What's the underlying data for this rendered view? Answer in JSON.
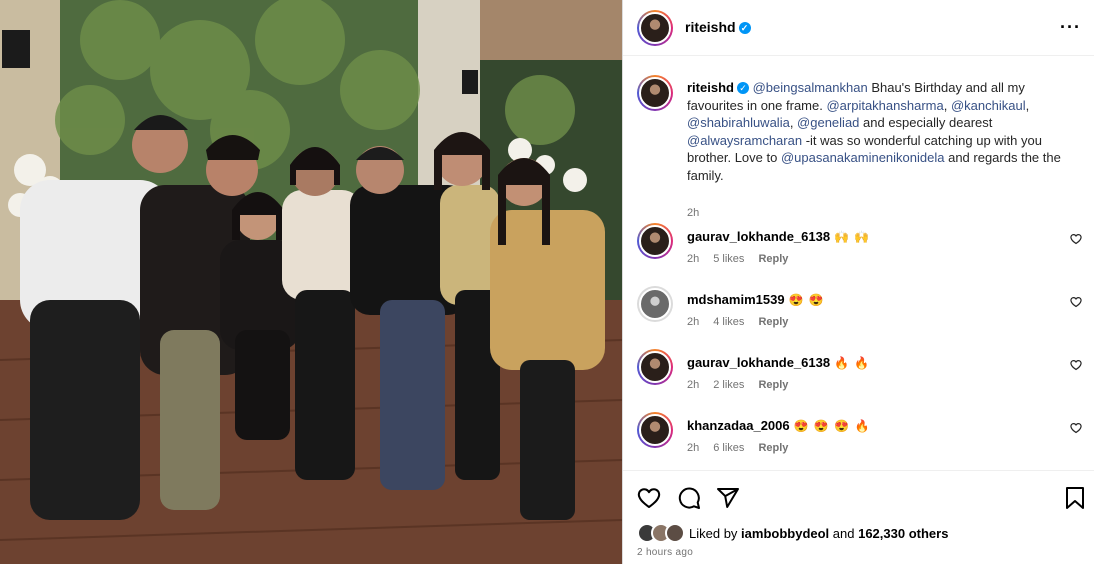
{
  "post": {
    "author": "riteishd",
    "more_icon": "more-horizontal-icon",
    "photo_alt": "Group photo of eight friends posing together indoors"
  },
  "caption": {
    "author": "riteishd",
    "segments": [
      {
        "type": "mention",
        "text": "@beingsalmankhan"
      },
      {
        "type": "text",
        "text": " Bhau's Birthday and all my favourites in one frame. "
      },
      {
        "type": "mention",
        "text": "@arpitakhansharma"
      },
      {
        "type": "text",
        "text": ", "
      },
      {
        "type": "mention",
        "text": "@kanchikaul"
      },
      {
        "type": "text",
        "text": ", "
      },
      {
        "type": "mention",
        "text": "@shabirahluwalia"
      },
      {
        "type": "text",
        "text": ", "
      },
      {
        "type": "mention",
        "text": "@geneliad"
      },
      {
        "type": "text",
        "text": " and especially dearest "
      },
      {
        "type": "mention",
        "text": "@alwaysramcharan"
      },
      {
        "type": "text",
        "text": " -it was so wonderful catching up with you brother. Love to "
      },
      {
        "type": "mention",
        "text": "@upasanakaminenikonidela"
      },
      {
        "type": "text",
        "text": " and regards the the family."
      }
    ],
    "time": "2h"
  },
  "comments": [
    {
      "user": "gaurav_lokhande_6138",
      "text": "🙌 🙌",
      "time": "2h",
      "likes": "5 likes",
      "reply": "Reply",
      "avatar": "dark"
    },
    {
      "user": "mdshamim1539",
      "text": "😍 😍",
      "time": "2h",
      "likes": "4 likes",
      "reply": "Reply",
      "avatar": "light"
    },
    {
      "user": "gaurav_lokhande_6138",
      "text": "🔥 🔥",
      "time": "2h",
      "likes": "2 likes",
      "reply": "Reply",
      "avatar": "dark"
    },
    {
      "user": "khanzadaa_2006",
      "text": "😍 😍 😍 🔥",
      "time": "2h",
      "likes": "6 likes",
      "reply": "Reply",
      "avatar": "dark"
    }
  ],
  "actions": {
    "like_icon": "heart-icon",
    "comment_icon": "comment-icon",
    "share_icon": "share-icon",
    "save_icon": "bookmark-icon"
  },
  "likes_summary": {
    "prefix": "Liked by ",
    "liker": "iambobbydeol",
    "middle": " and ",
    "count": "162,330 others"
  },
  "posted_ago": "2 hours ago",
  "colors": {
    "mention": "#385185",
    "verified": "#0095f6",
    "meta": "#737373"
  }
}
